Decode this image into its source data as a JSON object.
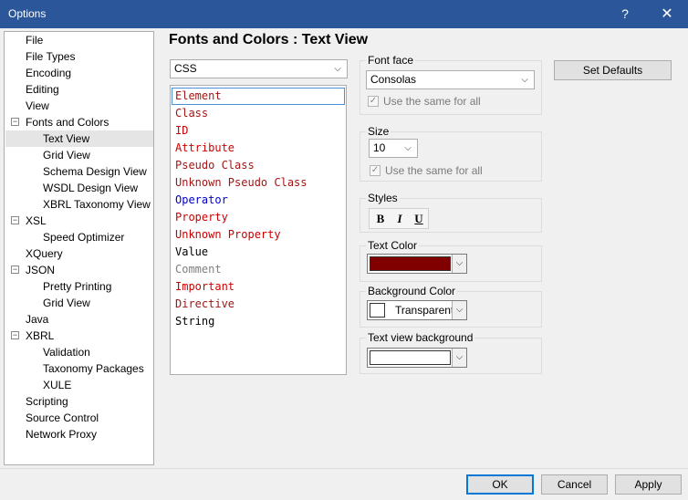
{
  "window": {
    "title": "Options",
    "help_glyph": "?",
    "close_glyph": "✕"
  },
  "tree": {
    "items": [
      {
        "label": "File"
      },
      {
        "label": "File Types"
      },
      {
        "label": "Encoding"
      },
      {
        "label": "Editing"
      },
      {
        "label": "View"
      },
      {
        "label": "Fonts and Colors"
      },
      {
        "label": "Text View"
      },
      {
        "label": "Grid View"
      },
      {
        "label": "Schema Design View"
      },
      {
        "label": "WSDL Design View"
      },
      {
        "label": "XBRL Taxonomy View"
      },
      {
        "label": "XSL"
      },
      {
        "label": "Speed Optimizer"
      },
      {
        "label": "XQuery"
      },
      {
        "label": "JSON"
      },
      {
        "label": "Pretty Printing"
      },
      {
        "label": "Grid View"
      },
      {
        "label": "Java"
      },
      {
        "label": "XBRL"
      },
      {
        "label": "Validation"
      },
      {
        "label": "Taxonomy Packages"
      },
      {
        "label": "XULE"
      },
      {
        "label": "Scripting"
      },
      {
        "label": "Source Control"
      },
      {
        "label": "Network Proxy"
      }
    ],
    "expander_glyph": "−"
  },
  "panel": {
    "title": "Fonts and Colors : Text View"
  },
  "language_select": {
    "value": "CSS"
  },
  "elements": {
    "items": [
      {
        "label": "Element",
        "color": "#a31515"
      },
      {
        "label": "Class",
        "color": "#a31515"
      },
      {
        "label": "ID",
        "color": "#cc0000"
      },
      {
        "label": "Attribute",
        "color": "#cc0000"
      },
      {
        "label": "Pseudo Class",
        "color": "#a31515"
      },
      {
        "label": "Unknown Pseudo Class",
        "color": "#a31515"
      },
      {
        "label": "Operator",
        "color": "#0000cc"
      },
      {
        "label": "Property",
        "color": "#cc0000"
      },
      {
        "label": "Unknown Property",
        "color": "#cc0000"
      },
      {
        "label": "Value",
        "color": "#000000"
      },
      {
        "label": "Comment",
        "color": "#808080"
      },
      {
        "label": "Important",
        "color": "#cc0000"
      },
      {
        "label": "Directive",
        "color": "#a31515"
      },
      {
        "label": "String",
        "color": "#000000"
      }
    ]
  },
  "font_face": {
    "label": "Font face",
    "value": "Consolas",
    "same_for_all": "Use the same for all"
  },
  "size": {
    "label": "Size",
    "value": "10",
    "same_for_all": "Use the same for all"
  },
  "styles": {
    "label": "Styles",
    "bold": "B",
    "italic": "I",
    "underline": "U"
  },
  "text_color": {
    "label": "Text Color",
    "value": "#800000"
  },
  "background_color": {
    "label": "Background Color",
    "value": "Transparent"
  },
  "text_view_background": {
    "label": "Text view background"
  },
  "buttons": {
    "set_defaults": "Set Defaults",
    "ok": "OK",
    "cancel": "Cancel",
    "apply": "Apply"
  },
  "glyphs": {
    "dropdown": "⌵",
    "checked": "✓"
  }
}
